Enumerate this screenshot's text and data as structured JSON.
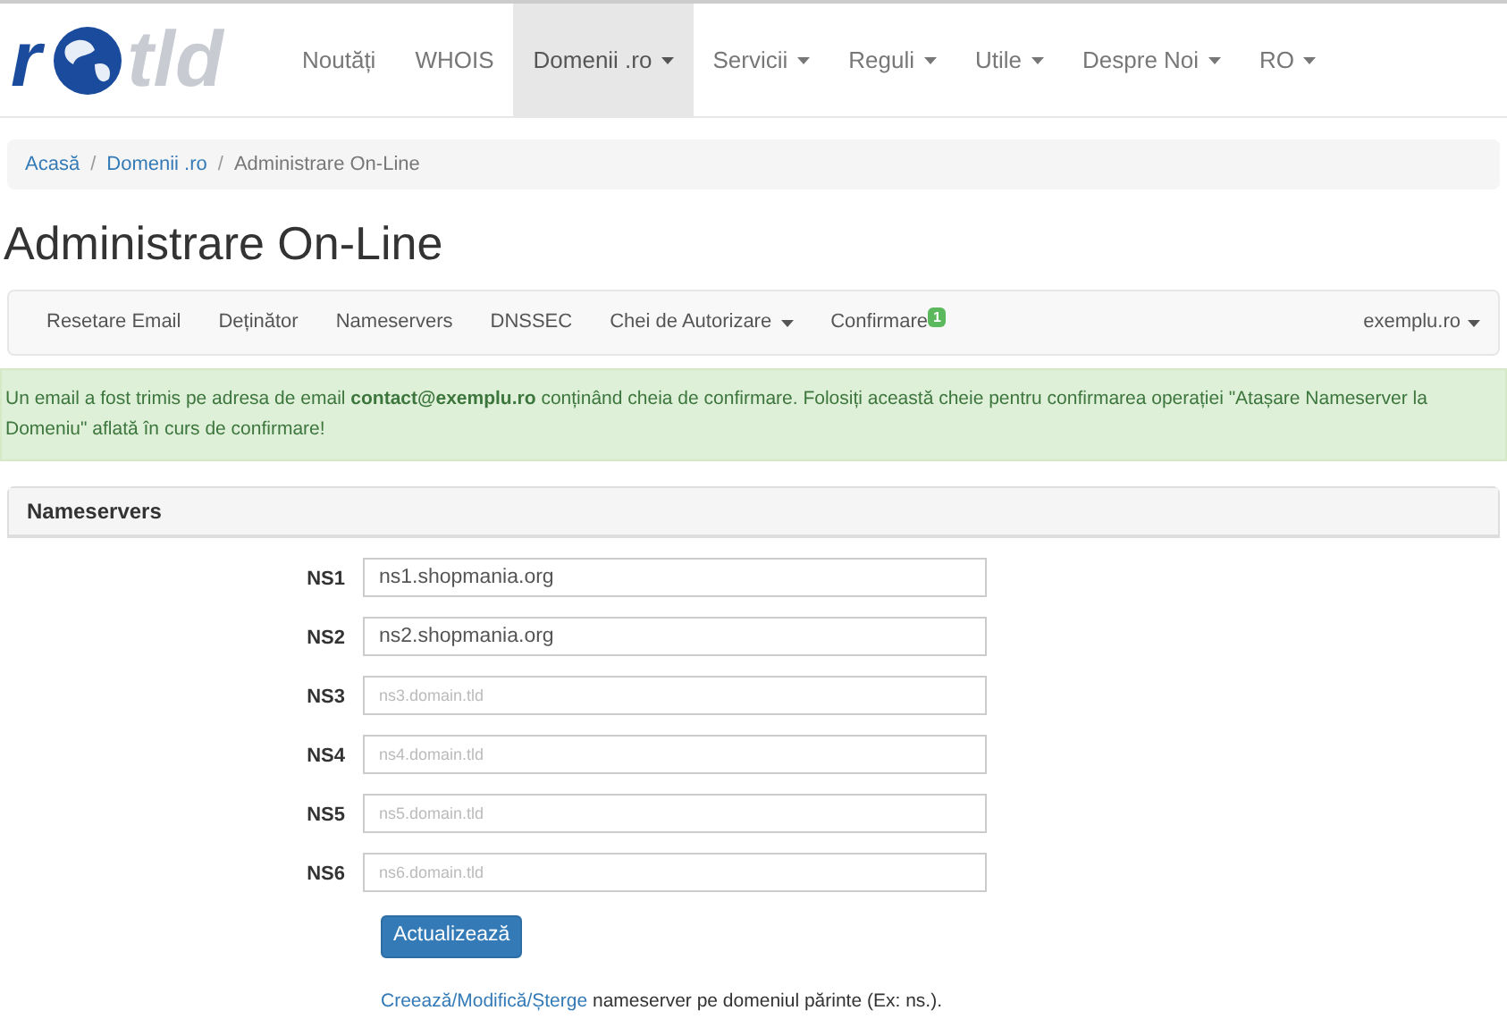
{
  "logo": {
    "left": "r",
    "right": "tld"
  },
  "nav": [
    {
      "label": "Noutăți",
      "selected": false,
      "dropdown": false
    },
    {
      "label": "WHOIS",
      "selected": false,
      "dropdown": false
    },
    {
      "label": "Domenii .ro",
      "selected": true,
      "dropdown": true
    },
    {
      "label": "Servicii",
      "selected": false,
      "dropdown": true
    },
    {
      "label": "Reguli",
      "selected": false,
      "dropdown": true
    },
    {
      "label": "Utile",
      "selected": false,
      "dropdown": true
    },
    {
      "label": "Despre Noi",
      "selected": false,
      "dropdown": true
    },
    {
      "label": "RO",
      "selected": false,
      "dropdown": true
    }
  ],
  "breadcrumb": [
    "Acasă",
    "Domenii .ro",
    "Administrare On-Line"
  ],
  "breadcrumb_separator": "/",
  "title": "Administrare On-Line",
  "subnav": [
    {
      "label": "Resetare Email",
      "dropdown": false
    },
    {
      "label": "Deținător",
      "dropdown": false
    },
    {
      "label": "Nameservers",
      "dropdown": false
    },
    {
      "label": "DNSSEC",
      "dropdown": false
    },
    {
      "label": "Chei de Autorizare",
      "dropdown": true
    },
    {
      "label": "Confirmare",
      "dropdown": false,
      "badge": "1"
    }
  ],
  "domain_menu": "exemplu.ro",
  "alert": "Un email a fost trimis pe adresa de email **contact@exemplu.ro** conținând cheia de confirmare. Folosiți această cheie pentru confirmarea operației \"Atașare Nameserver la Domeniu\" aflată în curs de confirmare!",
  "panel": {
    "title": "Nameservers",
    "fields": [
      {
        "label": "NS1",
        "value": "ns1.shopmania.org"
      },
      {
        "label": "NS2",
        "value": "ns2.shopmania.org"
      },
      {
        "label": "NS3",
        "placeholder": "ns3.domain.tld"
      },
      {
        "label": "NS4",
        "placeholder": "ns4.domain.tld"
      },
      {
        "label": "NS5",
        "placeholder": "ns5.domain.tld"
      },
      {
        "label": "NS6",
        "placeholder": "ns6.domain.tld"
      }
    ],
    "button": "Actualizează",
    "note_link": "Creează/Modifică/Șterge",
    "note_text": "nameserver pe domeniul părinte (Ex: ns.)."
  }
}
